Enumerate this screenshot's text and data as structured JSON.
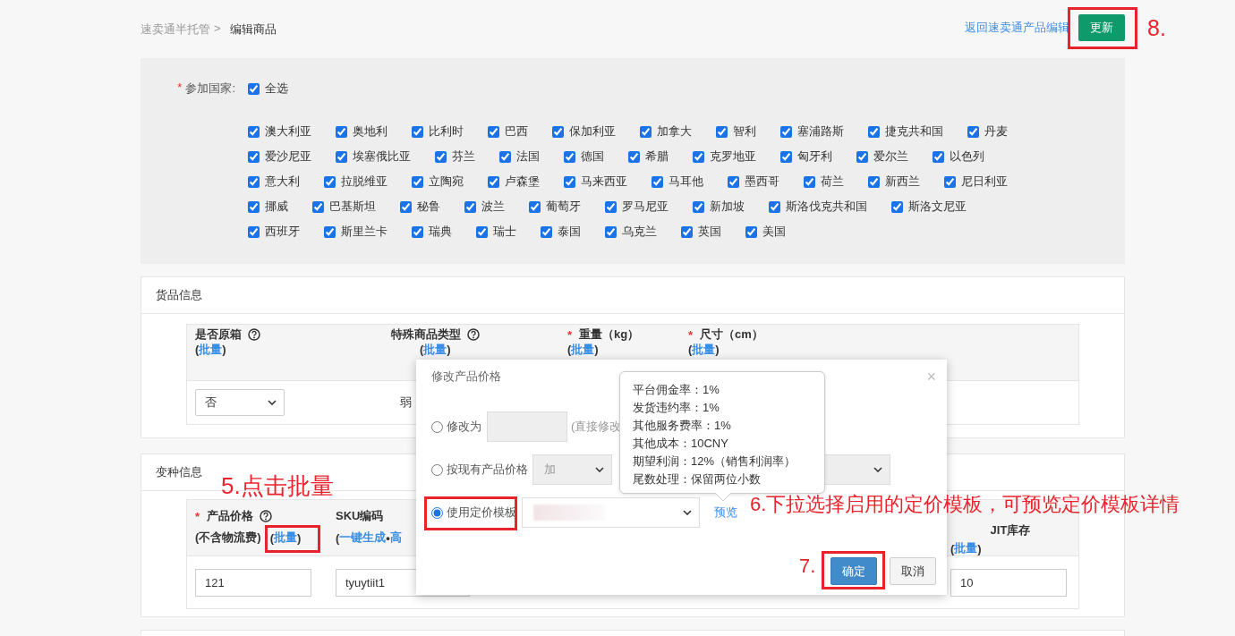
{
  "breadcrumb": {
    "parent": "速卖通半托管",
    "separator": ">",
    "current": "编辑商品"
  },
  "header_actions": {
    "back_link": "返回速卖通产品编辑",
    "update_button": "更新"
  },
  "countries": {
    "label": "参加国家:",
    "asterisk": "*",
    "select_all": {
      "label": "全选",
      "checked": true
    },
    "items": [
      {
        "name": "澳大利亚",
        "checked": true
      },
      {
        "name": "奥地利",
        "checked": true
      },
      {
        "name": "比利时",
        "checked": true
      },
      {
        "name": "巴西",
        "checked": true
      },
      {
        "name": "保加利亚",
        "checked": true
      },
      {
        "name": "加拿大",
        "checked": true
      },
      {
        "name": "智利",
        "checked": true
      },
      {
        "name": "塞浦路斯",
        "checked": true
      },
      {
        "name": "捷克共和国",
        "checked": true
      },
      {
        "name": "丹麦",
        "checked": true
      },
      {
        "name": "爱沙尼亚",
        "checked": true
      },
      {
        "name": "埃塞俄比亚",
        "checked": true
      },
      {
        "name": "芬兰",
        "checked": true
      },
      {
        "name": "法国",
        "checked": true
      },
      {
        "name": "德国",
        "checked": true
      },
      {
        "name": "希腊",
        "checked": true
      },
      {
        "name": "克罗地亚",
        "checked": true
      },
      {
        "name": "匈牙利",
        "checked": true
      },
      {
        "name": "爱尔兰",
        "checked": true
      },
      {
        "name": "以色列",
        "checked": true
      },
      {
        "name": "意大利",
        "checked": true
      },
      {
        "name": "拉脱维亚",
        "checked": true
      },
      {
        "name": "立陶宛",
        "checked": true
      },
      {
        "name": "卢森堡",
        "checked": true
      },
      {
        "name": "马来西亚",
        "checked": true
      },
      {
        "name": "马耳他",
        "checked": true
      },
      {
        "name": "墨西哥",
        "checked": true
      },
      {
        "name": "荷兰",
        "checked": true
      },
      {
        "name": "新西兰",
        "checked": true
      },
      {
        "name": "尼日利亚",
        "checked": true
      },
      {
        "name": "挪威",
        "checked": true
      },
      {
        "name": "巴基斯坦",
        "checked": true
      },
      {
        "name": "秘鲁",
        "checked": true
      },
      {
        "name": "波兰",
        "checked": true
      },
      {
        "name": "葡萄牙",
        "checked": true
      },
      {
        "name": "罗马尼亚",
        "checked": true
      },
      {
        "name": "新加坡",
        "checked": true
      },
      {
        "name": "斯洛伐克共和国",
        "checked": true
      },
      {
        "name": "斯洛文尼亚",
        "checked": true
      },
      {
        "name": "西班牙",
        "checked": true
      },
      {
        "name": "斯里兰卡",
        "checked": true
      },
      {
        "name": "瑞典",
        "checked": true
      },
      {
        "name": "瑞士",
        "checked": true
      },
      {
        "name": "泰国",
        "checked": true
      },
      {
        "name": "乌克兰",
        "checked": true
      },
      {
        "name": "英国",
        "checked": true
      },
      {
        "name": "美国",
        "checked": true
      }
    ]
  },
  "goods_info": {
    "title": "货品信息",
    "columns": [
      {
        "label": "是否原箱",
        "help": true,
        "batch": [
          "(",
          "批量",
          ")"
        ]
      },
      {
        "label": "特殊商品类型",
        "help": true,
        "batch": [
          "(",
          "批量",
          ")"
        ]
      },
      {
        "label": "重量（kg）",
        "asterisk": "*",
        "help": false,
        "batch": [
          "(",
          "批量",
          ")"
        ]
      },
      {
        "label": "尺寸（cm）",
        "asterisk": "*",
        "help": false,
        "batch": [
          "(",
          "批量",
          ")"
        ]
      }
    ],
    "row": [
      {
        "kind": "select",
        "value": "否"
      },
      {
        "kind": "text",
        "value": "弱"
      }
    ]
  },
  "variant_info": {
    "title": "变种信息",
    "columns": [
      {
        "label": "产品价格",
        "asterisk": "*",
        "help": true,
        "sublabel": "(不含物流费)",
        "batch": [
          "(",
          "批量",
          ")"
        ]
      },
      {
        "label": "SKU编码",
        "help": false,
        "actions": [
          "(",
          "一键生成",
          "•",
          "高"
        ]
      },
      {
        "label": "JIT库存",
        "help": false,
        "batch": [
          "(",
          "批量",
          ")"
        ]
      }
    ],
    "row": [
      {
        "value": "121"
      },
      {
        "value": "tyuytiit1"
      },
      {
        "value": "10"
      }
    ]
  },
  "price_dialog": {
    "title": "修改产品价格",
    "close": "×",
    "options": [
      {
        "kind": "input",
        "label": "修改为",
        "selected": false,
        "hint": "(直接修改"
      },
      {
        "kind": "adjust",
        "label": "按现有产品价格",
        "selected": false,
        "operator": "加"
      },
      {
        "kind": "template",
        "label": "使用定价模板",
        "selected": true,
        "preview_link": "预览"
      }
    ],
    "buttons": [
      {
        "label": "确定",
        "kind": "primary"
      },
      {
        "label": "取消",
        "kind": "default"
      }
    ]
  },
  "template_tooltip": {
    "lines": [
      "平台佣金率：1%",
      "发货违约率：1%",
      "其他服务费率：1%",
      "其他成本：10CNY",
      "期望利润：12%（销售利润率）",
      "尾数处理：保留两位小数"
    ]
  },
  "annotations": [
    {
      "text": "5.点击批量"
    },
    {
      "text": "6.下拉选择启用的定价模板，可预览定价模板详情"
    },
    {
      "text": "7."
    },
    {
      "text": "8."
    }
  ]
}
